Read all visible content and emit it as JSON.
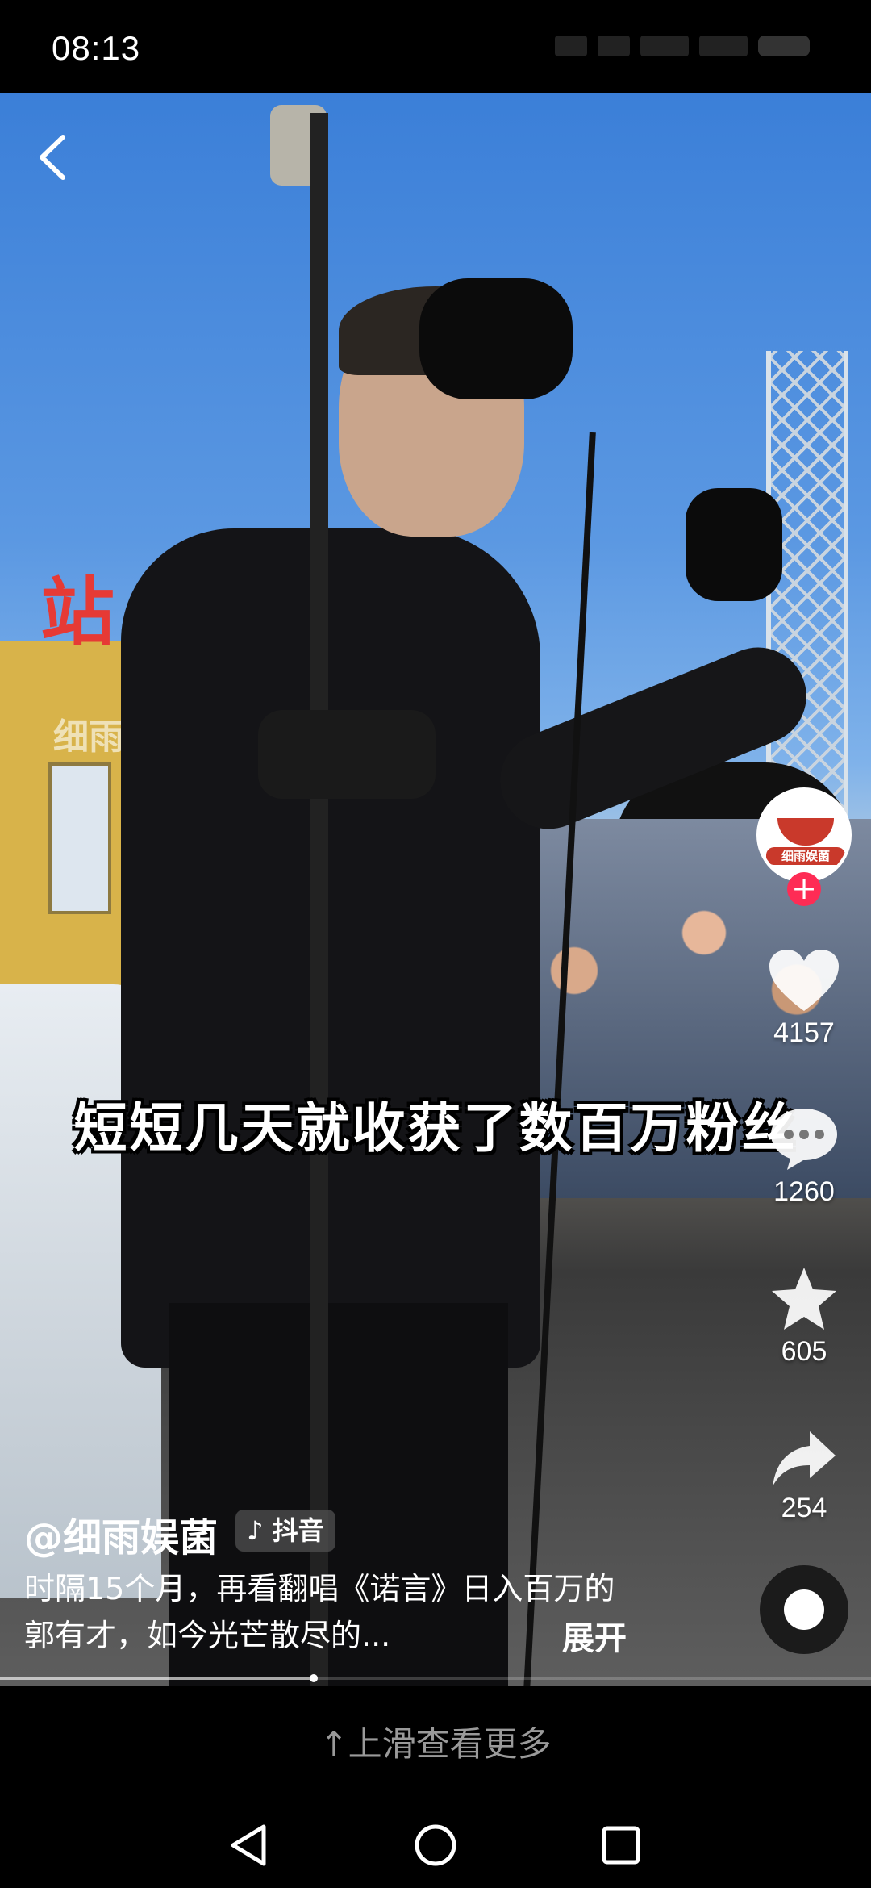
{
  "status_bar": {
    "time": "08:13"
  },
  "video": {
    "watermark": "细雨娱菌",
    "sign_text": "站",
    "caption": "短短几天就收获了数百万粉丝",
    "progress": 0.36
  },
  "rail": {
    "avatar_logo_text": "细雨娱菌",
    "follow_symbol": "+",
    "like_count": "4157",
    "comment_count": "1260",
    "favorite_count": "605",
    "share_count": "254"
  },
  "post": {
    "author": "@细雨娱菌",
    "source_tag": "抖音",
    "description": "时隔15个月，再看翻唱《诺言》日入百万的郭有才，如今光芒散尽的...",
    "expand_label": "展开"
  },
  "swipe_hint": "上滑查看更多",
  "icons": {
    "back": "chevron-left-icon",
    "like": "heart-icon",
    "comment": "comment-bubble-icon",
    "favorite": "star-icon",
    "share": "share-arrow-icon",
    "music": "music-disc-icon",
    "nav_back": "triangle-back-icon",
    "nav_home": "circle-home-icon",
    "nav_recent": "square-recents-icon"
  },
  "colors": {
    "follow_red": "#fe2c55",
    "hint_grey": "#9a9a9a"
  }
}
